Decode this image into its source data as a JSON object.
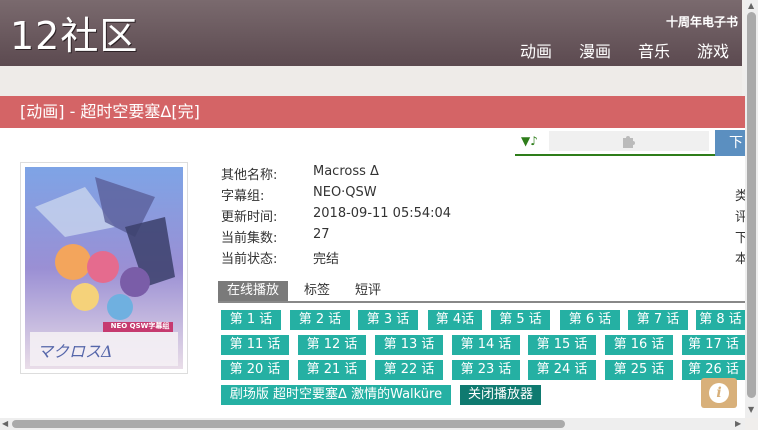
{
  "header": {
    "logo": "12社区",
    "ebook_link": "十周年电子书",
    "nav": [
      "动画",
      "漫画",
      "音乐",
      "游戏"
    ]
  },
  "title_bar": "[动画] - 超时空要塞Δ[完]",
  "player": {
    "music_label": "▼♪",
    "download_label": "下"
  },
  "info": {
    "rows": [
      {
        "k": "其他名称:",
        "v": "Macross Δ"
      },
      {
        "k": "字幕组:",
        "v": "NEO·QSW"
      },
      {
        "k": "更新时间:",
        "v": "2018-09-11 05:54:04"
      },
      {
        "k": "当前集数:",
        "v": "27"
      },
      {
        "k": "当前状态:",
        "v": "完结"
      }
    ],
    "side_chars": [
      "类",
      "评",
      "下",
      "本"
    ]
  },
  "cover": {
    "fansub_badge": "NEO QSW字幕组"
  },
  "tabs": [
    "在线播放",
    "标签",
    "短评"
  ],
  "episodes": [
    "第 1 话",
    "第 2 话",
    "第 3 话",
    "第 4话",
    "第 5 话",
    "第 6 话",
    "第 7 话",
    "第 8 话",
    "第 11 话",
    "第 12 话",
    "第 13 话",
    "第 14 话",
    "第 15 话",
    "第 16 话",
    "第 17 话",
    "第 20 话",
    "第 21 话",
    "第 22 话",
    "第 23 话",
    "第 24 话",
    "第 25 话",
    "第 26 话"
  ],
  "movie_button": "剧场版 超时空要塞Δ 激情的Walküre",
  "close_player": "关闭播放器",
  "colors": {
    "title_bar": "#d46466",
    "episode_button": "#25b0a3",
    "close_button": "#0f7a70",
    "header": "#6a5a5e"
  }
}
